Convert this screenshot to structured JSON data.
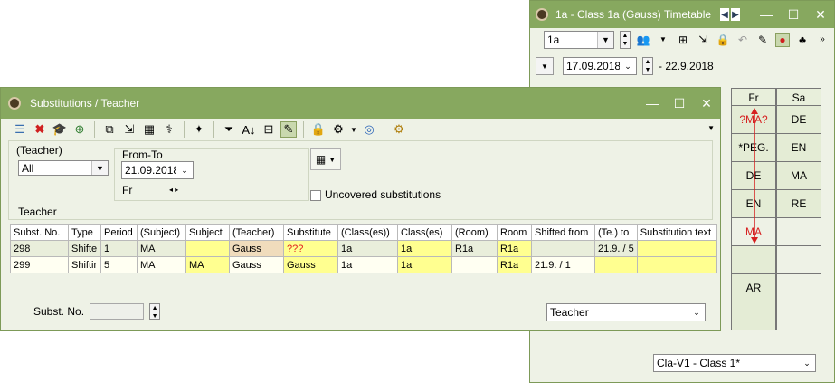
{
  "timetable": {
    "title": "1a - Class 1a (Gauss)  Timetable",
    "class_select": "1a",
    "date_from": "17.09.2018",
    "date_to": "- 22.9.2018",
    "days": [
      "Fr",
      "Sa"
    ],
    "rows": [
      [
        "?MA?",
        "DE"
      ],
      [
        "*PEG.",
        "EN"
      ],
      [
        "DE",
        "MA"
      ],
      [
        "EN",
        "RE"
      ],
      [
        "MA",
        ""
      ],
      [
        "",
        ""
      ],
      [
        "AR",
        ""
      ],
      [
        "",
        ""
      ]
    ],
    "bottom_combo": "Cla-V1 - Class 1*"
  },
  "subs": {
    "title": "Substitutions / Teacher",
    "filter": {
      "group_label": "(Teacher)",
      "group_value": "All",
      "fromto_label": "From-To",
      "date": "21.09.2018",
      "day": "Fr",
      "uncovered_label": "Uncovered substitutions",
      "section_label": "Teacher"
    },
    "columns": [
      "Subst. No.",
      "Type",
      "Period",
      "(Subject)",
      "Subject",
      "(Teacher)",
      "Substitute",
      "(Class(es))",
      "Class(es)",
      "(Room)",
      "Room",
      "Shifted from",
      "(Te.) to",
      "Substitution text"
    ],
    "rows": [
      [
        "298",
        "Shifte",
        "1",
        "MA",
        "",
        "Gauss",
        "???",
        "1a",
        "1a",
        "R1a",
        "R1a",
        "",
        "21.9. / 5",
        ""
      ],
      [
        "299",
        "Shiftir",
        "5",
        "MA",
        "MA",
        "Gauss",
        "Gauss",
        "1a",
        "1a",
        "",
        "R1a",
        "21.9. / 1",
        "",
        ""
      ]
    ],
    "bottom": {
      "subst_label": "Subst. No.",
      "view_combo": "Teacher"
    }
  },
  "colors": {
    "title_bar": "#87a85f",
    "window_bg": "#eef2e6",
    "highlight_yellow": "#ffff90",
    "highlight_tan": "#f0dcbc",
    "conflict_red": "#e02020"
  }
}
